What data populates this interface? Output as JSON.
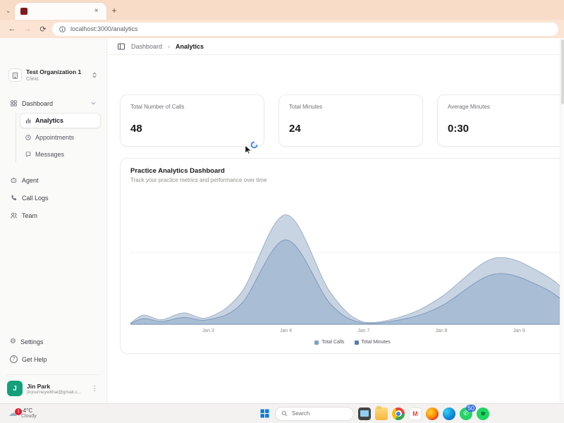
{
  "browser": {
    "tab_title": "",
    "close_tab_glyph": "×",
    "new_tab_glyph": "+",
    "tab_list_glyph": "⌄",
    "back_glyph": "←",
    "forward_glyph": "→",
    "refresh_glyph": "⟳",
    "url": "localhost:3000/analytics",
    "favicon_color": "#7d1d1d"
  },
  "breadcrumb": {
    "parent": "Dashboard",
    "separator": "›",
    "current": "Analytics"
  },
  "sidebar": {
    "org": {
      "name": "Test Organization 1",
      "subtitle": "Clinic"
    },
    "dashboard_label": "Dashboard",
    "dashboard_children": [
      "Analytics",
      "Appointments",
      "Messages"
    ],
    "items": [
      "Agent",
      "Call Logs",
      "Team"
    ],
    "footer_items": [
      "Settings",
      "Get Help"
    ],
    "settings_glyph": "⚙",
    "user": {
      "initial": "J",
      "name": "Jin Park",
      "email": "jinjourneywithai@gmail.c...",
      "avatar_color": "#13a07a",
      "menu_glyph": "⋮"
    }
  },
  "stats": [
    {
      "label": "Total Number of Calls",
      "value": "48"
    },
    {
      "label": "Total Minutes",
      "value": "24"
    },
    {
      "label": "Average Minutes",
      "value": "0:30"
    }
  ],
  "chart_card": {
    "title": "Practice Analytics Dashboard",
    "subtitle": "Track your practice metrics and performance over time"
  },
  "chart_data": {
    "type": "area",
    "title": "Practice Analytics Dashboard",
    "x_ticks": [
      "Jan 3",
      "Jan 4",
      "Jan 7",
      "Jan 8",
      "Jan 9"
    ],
    "tick_fractions": [
      0.175,
      0.35,
      0.525,
      0.7,
      0.875
    ],
    "ymax": 55,
    "grid": "minimal",
    "legend_position": "bottom",
    "series": [
      {
        "name": "Total Calls",
        "fill": "#c9d4e2",
        "stroke": "#9db1c9",
        "legend_color": "#7ba3c9",
        "points": [
          [
            0,
            0.5
          ],
          [
            0.03,
            4
          ],
          [
            0.07,
            2
          ],
          [
            0.12,
            5
          ],
          [
            0.175,
            3
          ],
          [
            0.25,
            14
          ],
          [
            0.35,
            48
          ],
          [
            0.45,
            14
          ],
          [
            0.525,
            1
          ],
          [
            0.62,
            4
          ],
          [
            0.7,
            12
          ],
          [
            0.82,
            29
          ],
          [
            0.93,
            22
          ],
          [
            1,
            11
          ]
        ]
      },
      {
        "name": "Total Minutes",
        "fill": "#a9bed5",
        "stroke": "#7e9abc",
        "legend_color": "#4f7fae",
        "points": [
          [
            0,
            0.3
          ],
          [
            0.03,
            2.5
          ],
          [
            0.07,
            1.2
          ],
          [
            0.12,
            3
          ],
          [
            0.175,
            2
          ],
          [
            0.25,
            9
          ],
          [
            0.35,
            37
          ],
          [
            0.45,
            9
          ],
          [
            0.525,
            0.5
          ],
          [
            0.62,
            2.5
          ],
          [
            0.7,
            8
          ],
          [
            0.82,
            22
          ],
          [
            0.93,
            16
          ],
          [
            1,
            6
          ]
        ]
      }
    ],
    "legend": [
      "Total Calls",
      "Total Minutes"
    ]
  },
  "taskbar": {
    "weather": {
      "badge": "1",
      "temperature": "-4°C",
      "condition": "Cloudy"
    },
    "search_label": "Search",
    "whatsapp_badge": "50"
  }
}
